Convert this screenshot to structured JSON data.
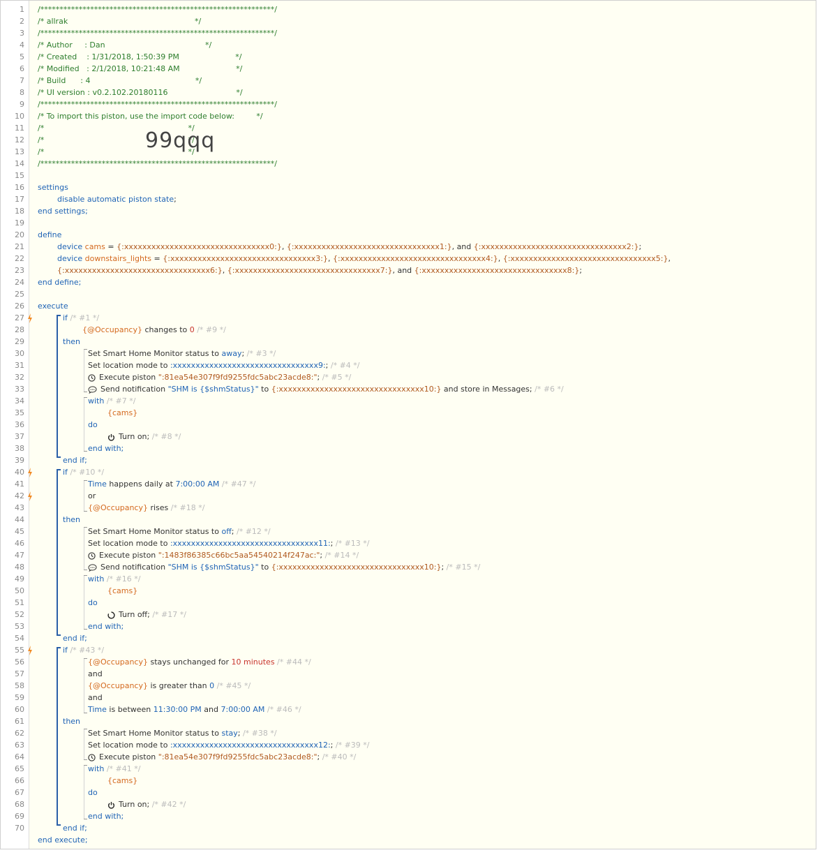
{
  "line_numbers": [
    "1",
    "2",
    "3",
    "4",
    "5",
    "6",
    "7",
    "8",
    "9",
    "10",
    "11",
    "12",
    "13",
    "14",
    "15",
    "16",
    "17",
    "18",
    "19",
    "20",
    "21",
    "22",
    "23",
    "24",
    "25",
    "26",
    "27",
    "28",
    "29",
    "30",
    "31",
    "32",
    "33",
    "34",
    "35",
    "36",
    "37",
    "38",
    "39",
    "40",
    "41",
    "42",
    "43",
    "44",
    "45",
    "46",
    "47",
    "48",
    "49",
    "50",
    "51",
    "52",
    "53",
    "54",
    "55",
    "56",
    "57",
    "58",
    "59",
    "60",
    "61",
    "62",
    "63",
    "64",
    "65",
    "66",
    "67",
    "68",
    "69",
    "70"
  ],
  "trigger_lines": [
    "27",
    "40",
    "42",
    "55"
  ],
  "header": {
    "border": "/*************************************************************/",
    "name_line": "/* allrak                                                    */",
    "author_line": "/* Author     : Dan                                         */",
    "created_line": "/* Created    : 1/31/2018, 1:50:39 PM                       */",
    "modified_line": "/* Modified   : 2/1/2018, 10:21:48 AM                       */",
    "build_line": "/* Build      : 4                                           */",
    "ui_version_line": "/* UI version : v0.2.102.20180116                            */",
    "import_line": "/* To import this piston, use the import code below:         */",
    "blank_line": "/*                                                           */",
    "import_code": "99qqq"
  },
  "settings": {
    "open": "settings",
    "option_kw": "disable automatic piston state",
    "close": "end settings;"
  },
  "define": {
    "open": "define",
    "cams_kw": "device",
    "cams_name": "cams",
    "cams_eq": " = ",
    "cams_d0": "{:xxxxxxxxxxxxxxxxxxxxxxxxxxxxxxxx0:}",
    "cams_d1": "{:xxxxxxxxxxxxxxxxxxxxxxxxxxxxxxxx1:}",
    "cams_d2": "{:xxxxxxxxxxxxxxxxxxxxxxxxxxxxxxxx2:}",
    "comma": ", ",
    "and": ", and ",
    "semi": ";",
    "lights_kw": "device",
    "lights_name": "downstairs_lights",
    "lights_d3": "{:xxxxxxxxxxxxxxxxxxxxxxxxxxxxxxxx3:}",
    "lights_d4": "{:xxxxxxxxxxxxxxxxxxxxxxxxxxxxxxxx4:}",
    "lights_d5": "{:xxxxxxxxxxxxxxxxxxxxxxxxxxxxxxxx5:}",
    "lights_d6": "{:xxxxxxxxxxxxxxxxxxxxxxxxxxxxxxxx6:}",
    "lights_d7": "{:xxxxxxxxxxxxxxxxxxxxxxxxxxxxxxxx7:}",
    "lights_d8": "{:xxxxxxxxxxxxxxxxxxxxxxxxxxxxxxxx8:}",
    "close": "end define;"
  },
  "execute": {
    "open": "execute",
    "close": "end execute;",
    "kw_if": "if",
    "kw_then": "then",
    "kw_end_if": "end if;",
    "kw_with": "with",
    "kw_do": "do",
    "kw_end_with": "end with;",
    "kw_or": "or",
    "kw_and": "and",
    "cams_ref": "{cams}",
    "occupancy": "{@Occupancy}",
    "time": "Time",
    "set_shm": "Set Smart Home Monitor status to ",
    "set_mode": "Set location mode to ",
    "exec_piston": "Execute piston ",
    "send_notif": "Send notification ",
    "notif_msg": "\"SHM is {$shmStatus}\"",
    "to": " to ",
    "semi": ";",
    "turn_on": "Turn on;",
    "turn_off": "Turn off;",
    "block1": {
      "if_c": "/* #1 */",
      "changes": " changes to ",
      "zero": "0",
      "cond_c": " /* #9 */",
      "shm": "away",
      "shm_c": " /* #3 */",
      "mode": ":xxxxxxxxxxxxxxxxxxxxxxxxxxxxxxxx9:",
      "mode_c": " /* #4 */",
      "piston": "\":81ea54e307f9fd9255fdc5abc23acde8:\"",
      "piston_c": " /* #5 */",
      "phone": "{:xxxxxxxxxxxxxxxxxxxxxxxxxxxxxxxx10:}",
      "store": " and store in Messages;",
      "notif_c": " /* #6 */",
      "with_c": "/* #7 */",
      "turn_c": " /* #8 */"
    },
    "block2": {
      "if_c": "/* #10 */",
      "happens": " happens daily at ",
      "time_val": "7:00:00 AM",
      "time_c": " /* #47 */",
      "rises": " rises",
      "rises_c": " /* #18 */",
      "shm": "off",
      "shm_c": " /* #12 */",
      "mode": ":xxxxxxxxxxxxxxxxxxxxxxxxxxxxxxxx11:",
      "mode_c": " /* #13 */",
      "piston": "\":1483f86385c66bc5aa54540214f247ac:\"",
      "piston_c": " /* #14 */",
      "phone": "{:xxxxxxxxxxxxxxxxxxxxxxxxxxxxxxxx10:}",
      "notif_c": " /* #15 */",
      "with_c": "/* #16 */",
      "turn_c": " /* #17 */"
    },
    "block3": {
      "if_c": "/* #43 */",
      "stays": " stays unchanged for ",
      "ten": "10 minutes",
      "stays_c": " /* #44 */",
      "greater": " is greater than ",
      "zero": "0",
      "greater_c": " /* #45 */",
      "between": " is between ",
      "t1": "11:30:00 PM",
      "t_and": " and ",
      "t2": "7:00:00 AM",
      "between_c": " /* #46 */",
      "shm": "stay",
      "shm_c": " /* #38 */",
      "mode": ":xxxxxxxxxxxxxxxxxxxxxxxxxxxxxxxx12:",
      "mode_c": " /* #39 */",
      "piston": "\":81ea54e307f9fd9255fdc5abc23acde8:\"",
      "piston_c": " /* #40 */",
      "with_c": "/* #41 */",
      "turn_c": " /* #42 */"
    }
  }
}
